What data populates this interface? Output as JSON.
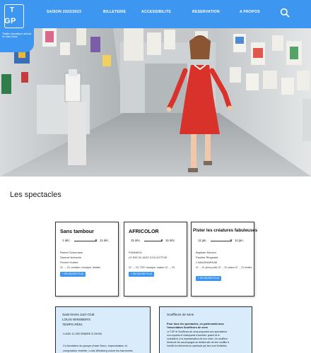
{
  "logo": {
    "t": "T",
    "gp": "GP",
    "caption": "Théâtre dramatique national de Saint-Denis"
  },
  "nav": {
    "items": [
      "SAISON 2022/2023",
      "BILLETERIE",
      "ACCESSIBILITE",
      "RESERVATION",
      "A PROPOS"
    ]
  },
  "icons": {
    "search": "search-icon",
    "arrow": "arrow-right-icon"
  },
  "colors": {
    "brand": "#3d96f0",
    "info_bg": "#d9ecfb",
    "dress": "#d8322a"
  },
  "spectacles": {
    "title": "Les spectacles",
    "cards": [
      {
        "title": "Sans tambour",
        "start": "1 déc.",
        "end": "11 déc.",
        "people": [
          "Robert Schumann",
          "Samuel Achache",
          "Florent Hubert"
        ],
        "tags": "22 → 23, création, musique, théâtre",
        "button": "+ EN SAVOIR PLUS"
      },
      {
        "title": "AFRICOLOR",
        "start": "15 déc.",
        "end": "15 déc.",
        "people": [
          "FANNKKA",
          "LE BIG IN JAZZ COLLECTIVE"
        ],
        "tags": "22 → 23, TGP, musique, saison 22 → 23",
        "button": "+ EN SAVOIR PLUS"
      },
      {
        "title": "Pister les créatures fabuleuses",
        "start": "11 jan.",
        "end": "14 jan.",
        "people": [
          "Baptiste Morizot",
          "Pauline Ringeade",
          "L'IMAGINARIUM"
        ],
        "tags": "22 → 23, jeune public 22 → 23, saison 22 → 23, théâtre",
        "button": "+ EN SAVOIR PLUS"
      }
    ]
  },
  "info_left": {
    "venue": "Saint-Denis Jazz-Club",
    "name": "LOUIS WINSBERG",
    "subtitle": "TEMPS RÉEL",
    "date": "LUNDI 12 DÉCEMBRE À 20H30",
    "lines": [
      "Co-fondateur du groupe phare Sixun, improvisateur et",
      "compositeur émérite, Louis Winsberg colore les harmonies"
    ]
  },
  "info_right": {
    "title": "Souffleurs de sens",
    "bold_lines": [
      "Pour tous les spectacles, en partenariat avec",
      "l'association Souffleurs de sens"
    ],
    "lines": [
      "Le TGP et Souffleurs de sens proposent aux spectateurs",
      "non-voyants et malvoyants d'accéder, quand ils le",
      "souhaitent, à la représentation de leur choix. Un souffleur",
      "bénévole les accompagne au théâtre afin de leur souffler à",
      "l'oreille les éléments du spectacle qui leur sont invisibles."
    ]
  }
}
